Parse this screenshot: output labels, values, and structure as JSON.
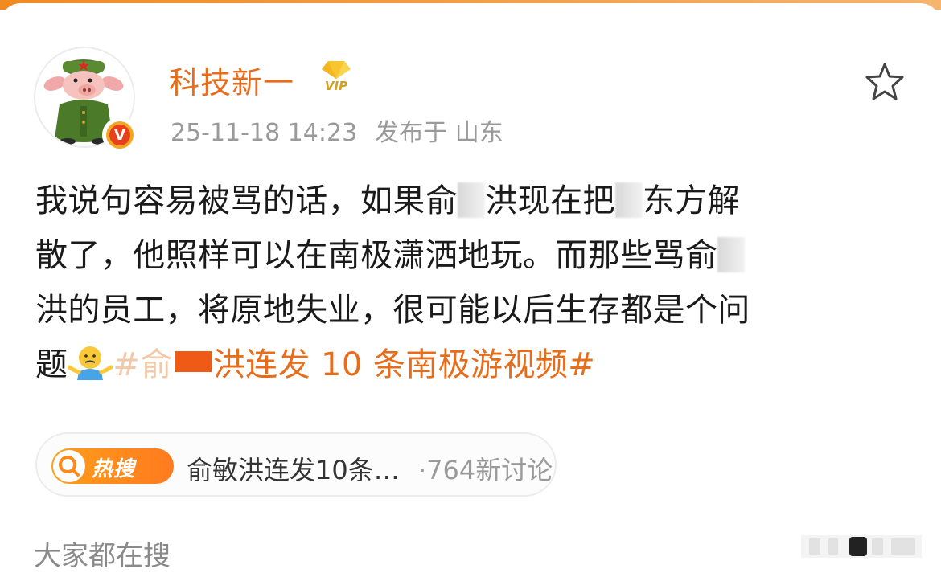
{
  "header": {
    "username": "科技新一",
    "timestamp": "25-11-18 14:23",
    "location": "发布于 山东",
    "vip_badge": "VIP"
  },
  "post": {
    "line1a": "我说句容易被骂的话，如果俞",
    "line1b": "洪现在把",
    "line1c": "东方解",
    "line2a": "散了，他照样可以在南极潇洒地玩。而那些骂俞",
    "line3": "洪的员工，将原地失业，很可能以后生存都是个问",
    "line4a": "题",
    "hashtag": "#俞敏洪连发10条南极游视频#",
    "hashtag_tail": "洪连发 10 条南极游视频#"
  },
  "hot_search": {
    "badge": "热搜",
    "title": "俞敏洪连发10条…",
    "count": "·764新讨论"
  },
  "footer": {
    "section_title": "大家都在搜"
  },
  "colors": {
    "accent": "#e86d1b",
    "top_strip": "#f08a22",
    "muted_text": "#9a9a9a",
    "body_text": "#1a1a1a"
  },
  "icons": {
    "favorite": "star-icon",
    "verified": "verified-badge-icon",
    "vip": "vip-crown-icon",
    "emoji": "shrug-emoji-icon",
    "hot": "hot-search-icon"
  }
}
